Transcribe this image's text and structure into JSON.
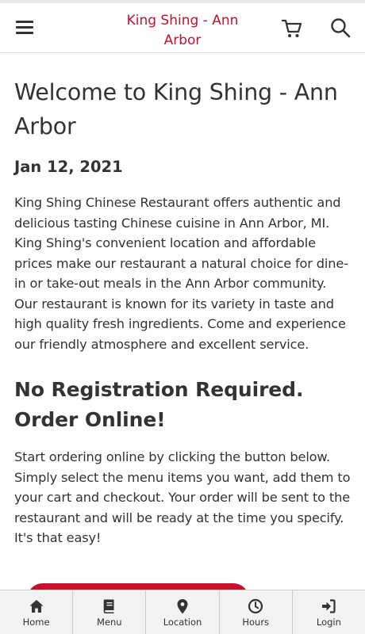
{
  "header": {
    "menu_icon": "hamburger-icon",
    "title": "King Shing - Ann Arbor",
    "cart_icon": "cart-icon",
    "search_icon": "search-icon",
    "brand_color": "#c8102e"
  },
  "main": {
    "heading": "Welcome to King Shing - Ann Arbor",
    "date": "Jan 12, 2021",
    "intro": "King Shing Chinese Restaurant offers authentic and delicious tasting Chinese cuisine in Ann Arbor, MI. King Shing's convenient location and affordable prices make our restaurant a natural choice for dine-in or take-out meals in the Ann Arbor community. Our restaurant is known for its variety in taste and high quality fresh ingredients. Come and experience our friendly atmosphere and excellent service.",
    "subheading": "No Registration Required. Order Online!",
    "order_text": "Start ordering online by clicking the button below. Simply select the menu items you want, add them to your cart and checkout. Your order will be sent to the restaurant and will be ready at the time you specify. It's that easy!"
  },
  "bottom_nav": {
    "items": [
      {
        "label": "Home",
        "icon": "home-icon"
      },
      {
        "label": "Menu",
        "icon": "book-icon"
      },
      {
        "label": "Location",
        "icon": "map-pin-icon"
      },
      {
        "label": "Hours",
        "icon": "clock-icon"
      },
      {
        "label": "Login",
        "icon": "sign-in-icon"
      }
    ]
  }
}
